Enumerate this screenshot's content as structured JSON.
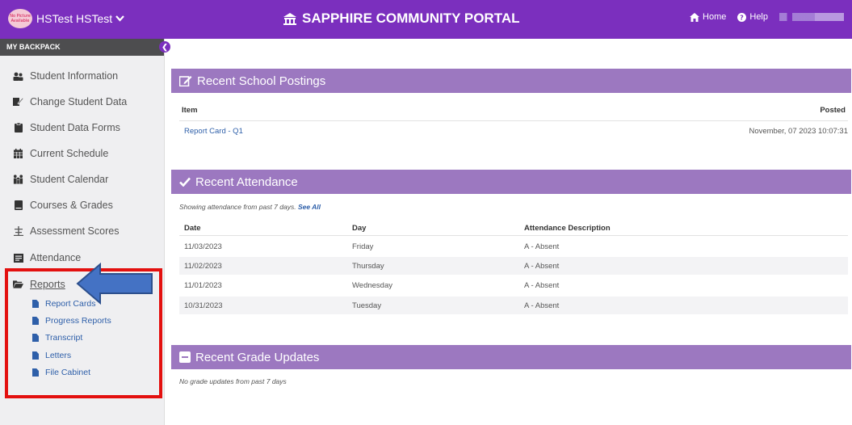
{
  "topbar": {
    "avatar_text": "No Picture Available",
    "user_name": "HSTest HSTest",
    "portal_title": "SAPPHIRE COMMUNITY PORTAL",
    "home_label": "Home",
    "help_label": "Help"
  },
  "sidebar": {
    "header": "MY BACKPACK",
    "items": [
      {
        "label": "Student Information",
        "icon": "users-icon"
      },
      {
        "label": "Change Student Data",
        "icon": "edit-icon"
      },
      {
        "label": "Student Data Forms",
        "icon": "clipboard-icon"
      },
      {
        "label": "Current Schedule",
        "icon": "calendar-grid-icon"
      },
      {
        "label": "Student Calendar",
        "icon": "family-icon"
      },
      {
        "label": "Courses & Grades",
        "icon": "book-icon"
      },
      {
        "label": "Assessment Scores",
        "icon": "scale-icon"
      },
      {
        "label": "Attendance",
        "icon": "attendance-icon"
      },
      {
        "label": "Reports",
        "icon": "folder-open-icon"
      }
    ],
    "report_subitems": [
      "Report Cards",
      "Progress Reports",
      "Transcript",
      "Letters",
      "File Cabinet"
    ]
  },
  "postings": {
    "title": "Recent School Postings",
    "col_item": "Item",
    "col_posted": "Posted",
    "rows": [
      {
        "item": "Report Card - Q1",
        "posted": "November, 07 2023 10:07:31"
      }
    ]
  },
  "attendance": {
    "title": "Recent Attendance",
    "note": "Showing attendance from past 7 days.",
    "see_all": "See All",
    "col_date": "Date",
    "col_day": "Day",
    "col_desc": "Attendance Description",
    "rows": [
      {
        "date": "11/03/2023",
        "day": "Friday",
        "desc": "A - Absent"
      },
      {
        "date": "11/02/2023",
        "day": "Thursday",
        "desc": "A - Absent"
      },
      {
        "date": "11/01/2023",
        "day": "Wednesday",
        "desc": "A - Absent"
      },
      {
        "date": "10/31/2023",
        "day": "Tuesday",
        "desc": "A - Absent"
      }
    ]
  },
  "grades": {
    "title": "Recent Grade Updates",
    "note": "No grade updates from past 7 days"
  },
  "colors": {
    "brand": "#7b2fbe",
    "panel": "#9c78c0",
    "highlight": "#e3100f",
    "arrow": "#4472c4"
  }
}
